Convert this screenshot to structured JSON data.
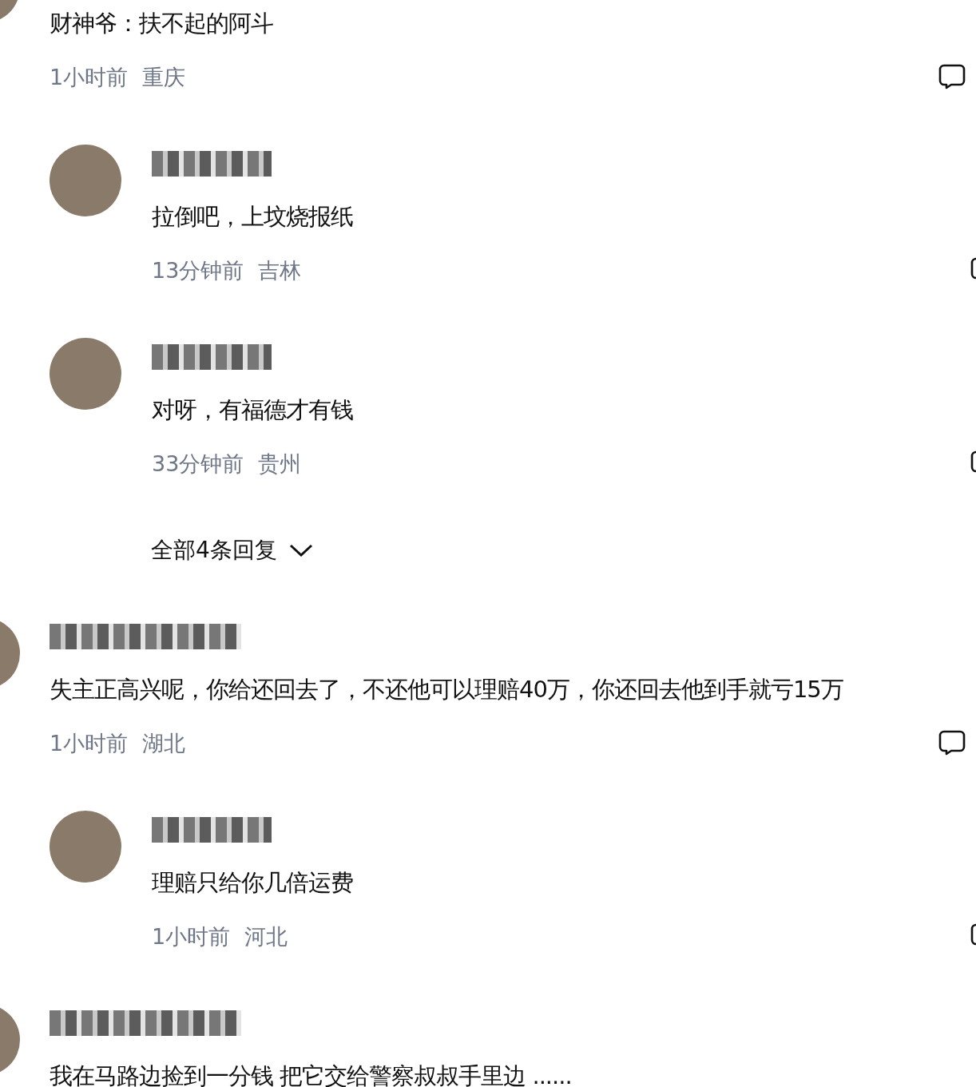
{
  "comments": [
    {
      "text": "财神爷：扶不起的阿斗",
      "time": "1小时前",
      "location": "重庆",
      "replies": [
        {
          "name_obscured": true,
          "text": "拉倒吧，上坟烧报纸",
          "time": "13分钟前",
          "location": "吉林"
        },
        {
          "name_obscured": true,
          "text": "对呀，有福德才有钱",
          "time": "33分钟前",
          "location": "贵州"
        }
      ],
      "more_replies": "全部4条回复"
    },
    {
      "name_obscured": true,
      "text": "失主正高兴呢，你给还回去了，不还他可以理赔40万，你还回去他到手就亏15万",
      "time": "1小时前",
      "location": "湖北",
      "replies": [
        {
          "name_obscured": true,
          "text": "理赔只给你几倍运费",
          "time": "1小时前",
          "location": "河北"
        }
      ]
    },
    {
      "name_obscured": true,
      "text": "我在马路边捡到一分钱 把它交给警察叔叔手里边 ......"
    }
  ]
}
